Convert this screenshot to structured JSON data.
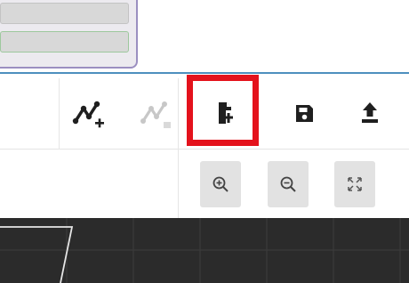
{
  "colors": {
    "panel_border": "#9b8fc0",
    "accent_rule": "#4d8fbe",
    "highlight": "#e4121c",
    "icon_dark": "#1f1f1f",
    "icon_disabled": "#c7c7c7",
    "zoom_button_bg": "#e2e2e2",
    "canvas_bg": "#2b2b2b"
  },
  "toolbar": {
    "tools": [
      {
        "id": "add-path",
        "icon": "path-plus-icon",
        "enabled": true
      },
      {
        "id": "remove-path",
        "icon": "path-minus-icon",
        "enabled": false
      },
      {
        "id": "import-file",
        "icon": "file-import-icon",
        "enabled": true,
        "highlighted": true
      },
      {
        "id": "save",
        "icon": "floppy-disk-icon",
        "enabled": true
      },
      {
        "id": "export",
        "icon": "upload-icon",
        "enabled": true
      }
    ]
  },
  "zoom_controls": [
    {
      "id": "zoom-in",
      "icon": "zoom-in-icon"
    },
    {
      "id": "zoom-out",
      "icon": "zoom-out-icon"
    },
    {
      "id": "fit",
      "icon": "fit-screen-icon"
    }
  ]
}
